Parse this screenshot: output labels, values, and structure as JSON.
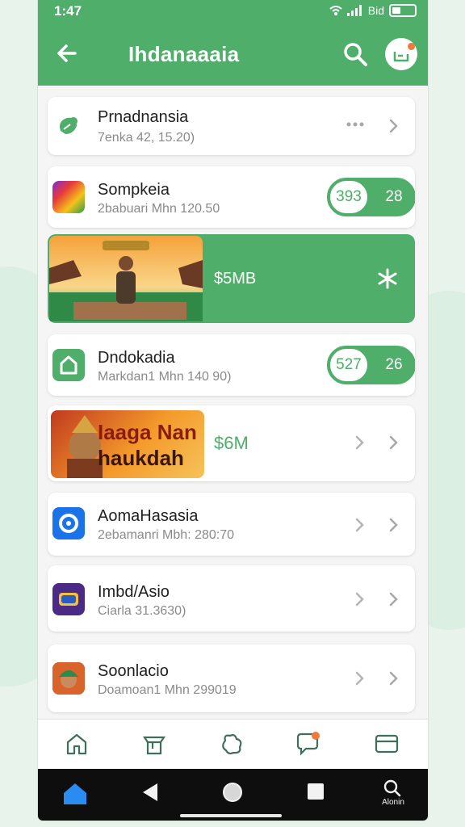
{
  "status": {
    "time": "1:47",
    "right_text": "Bid"
  },
  "appbar": {
    "title": "Ihdanaaaia"
  },
  "items": [
    {
      "name": "Prnadnansia",
      "sub": "7enka  42, 15.20)"
    },
    {
      "name": "Sompkeia",
      "sub": "2babuari Mhn 120.50",
      "pill_left": "393",
      "pill_right": "28"
    },
    {
      "banner_value": "$5MB"
    },
    {
      "name": "Dndokadia",
      "sub": "Markdan1 Mhn 140 90)",
      "pill_left": "527",
      "pill_right": "26"
    },
    {
      "banner_line1": "Iaaga Nan",
      "banner_line2": "haukdah",
      "banner_value": "$6M"
    },
    {
      "name": "AomaHasasia",
      "sub": "2ebamanri Mbh: 280:70"
    },
    {
      "name": "Imbd/Asio",
      "sub": "Ciarla  31.3630)"
    },
    {
      "name": "Soonlacio",
      "sub": "Doamoan1 Mhn 299019"
    }
  ],
  "sysnav": {
    "search_label": "Alonin"
  },
  "colors": {
    "accent": "#4fae6a",
    "badge": "#f07a3a"
  },
  "icons": [
    "arrow-back-icon",
    "search-icon",
    "profile-icon",
    "home-icon",
    "store-icon",
    "game-icon",
    "chat-icon",
    "wallet-icon"
  ]
}
